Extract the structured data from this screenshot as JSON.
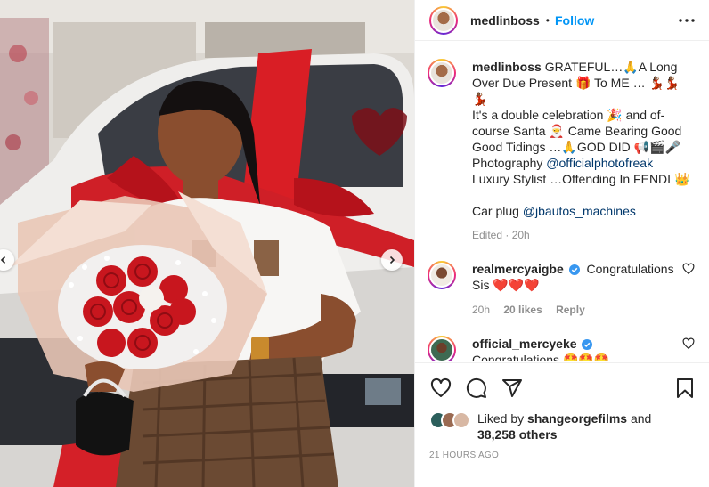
{
  "post": {
    "image_description_icons": [
      "chevron-left-icon",
      "chevron-right-icon"
    ]
  },
  "header": {
    "username": "medlinboss",
    "separator": "•",
    "follow_label": "Follow"
  },
  "caption": {
    "username": "medlinboss",
    "lines": [
      "GRATEFUL…🙏A Long",
      "Over Due Present 🎁 To ME … 💃🏾💃🏾💃🏾",
      "It's a double celebration 🎉 and of-",
      "course Santa 🎅 Came Bearing Good",
      "Good Tidings …🙏GOD DID 📢🎬🎤"
    ],
    "photography_label": "Photography ",
    "photography_mention": "@officialphotofreak",
    "stylist_line": "Luxury Stylist …Offending In FENDI 👑",
    "car_plug_label": "Car plug ",
    "car_plug_mention": "@jbautos_machines",
    "edited": "Edited · 20h"
  },
  "comments": [
    {
      "username": "realmercyaigbe",
      "verified": true,
      "text": "Congratulations",
      "text2": "Sis ❤️❤️❤️",
      "time": "20h",
      "likes": "20 likes",
      "reply": "Reply"
    },
    {
      "username": "official_mercyeke",
      "verified": true,
      "text": "Congratulations 🤩🤩🤩"
    }
  ],
  "likes": {
    "prefix": "Liked by ",
    "user": "shangeorgefilms",
    "middle": " and",
    "count": "38,258 others"
  },
  "timestamp": "21 HOURS AGO",
  "colors": {
    "link_blue": "#0095f6",
    "mention": "#00376b",
    "meta_gray": "#8e8e8e",
    "verified": "#3897f0"
  }
}
